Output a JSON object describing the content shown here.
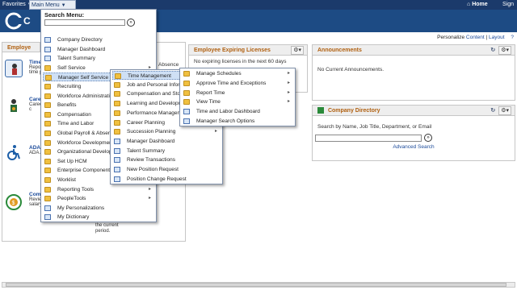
{
  "topbar": {
    "favorites": "Favorites",
    "main_menu": "Main Menu",
    "home": "Home",
    "sign_out": "Sign"
  },
  "personalize": {
    "prefix": "Personalize",
    "content": "Content",
    "sep": "|",
    "layout": "Layout",
    "help": "?"
  },
  "employee_pagelet": {
    "title": "Employe",
    "absence": "Absence",
    "current_period": "the current period.",
    "tiles": [
      {
        "title": "Time",
        "desc": "Repo and t a day time p"
      },
      {
        "title": "Care",
        "desc": "Caree jobs a your c"
      },
      {
        "title": "ADA Acco Requ",
        "desc": "ADA Acco Requ"
      },
      {
        "title": "Comp Histo",
        "desc": "Revie comp histor salary options."
      }
    ]
  },
  "licenses_pagelet": {
    "title": "Employee Expiring Licenses",
    "empty": "No expiring licenses in the next 60 days"
  },
  "announcements_pagelet": {
    "title": "Announcements",
    "empty": "No Current Announcements."
  },
  "directory_pagelet": {
    "title": "Company Directory",
    "search_label": "Search by Name, Job Title, Department, or Email",
    "advanced": "Advanced Search",
    "input_value": ""
  },
  "main_menu": {
    "search_label": "Search Menu:",
    "search_value": "",
    "items": [
      {
        "label": "Company Directory",
        "type": "page",
        "arrow": false
      },
      {
        "label": "Manager Dashboard",
        "type": "page",
        "arrow": false
      },
      {
        "label": "Talent Summary",
        "type": "page",
        "arrow": false
      },
      {
        "label": "Self Service",
        "type": "folder",
        "arrow": true
      },
      {
        "label": "Manager Self Service",
        "type": "folder",
        "arrow": true
      },
      {
        "label": "Recruiting",
        "type": "folder",
        "arrow": true
      },
      {
        "label": "Workforce Administration",
        "type": "folder",
        "arrow": true
      },
      {
        "label": "Benefits",
        "type": "folder",
        "arrow": true
      },
      {
        "label": "Compensation",
        "type": "folder",
        "arrow": true
      },
      {
        "label": "Time and Labor",
        "type": "folder",
        "arrow": true
      },
      {
        "label": "Global Payroll & Absence",
        "type": "folder",
        "arrow": true
      },
      {
        "label": "Workforce Development",
        "type": "folder",
        "arrow": true
      },
      {
        "label": "Organizational Development",
        "type": "folder",
        "arrow": true
      },
      {
        "label": "Set Up HCM",
        "type": "folder",
        "arrow": true
      },
      {
        "label": "Enterprise Components",
        "type": "folder",
        "arrow": true
      },
      {
        "label": "Worklist",
        "type": "folder",
        "arrow": true
      },
      {
        "label": "Reporting Tools",
        "type": "folder",
        "arrow": true
      },
      {
        "label": "PeopleTools",
        "type": "folder",
        "arrow": true
      },
      {
        "label": "My Personalizations",
        "type": "page",
        "arrow": false
      },
      {
        "label": "My Dictionary",
        "type": "page",
        "arrow": false
      }
    ]
  },
  "submenu_mss": {
    "items": [
      {
        "label": "Time Management",
        "type": "folder",
        "arrow": true
      },
      {
        "label": "Job and Personal Information",
        "type": "folder",
        "arrow": true
      },
      {
        "label": "Compensation and Stock",
        "type": "folder",
        "arrow": true
      },
      {
        "label": "Learning and Development",
        "type": "folder",
        "arrow": true
      },
      {
        "label": "Performance Management",
        "type": "folder",
        "arrow": true
      },
      {
        "label": "Career Planning",
        "type": "folder",
        "arrow": true
      },
      {
        "label": "Succession Planning",
        "type": "folder",
        "arrow": true
      },
      {
        "label": "Manager Dashboard",
        "type": "page",
        "arrow": false
      },
      {
        "label": "Talent Summary",
        "type": "page",
        "arrow": false
      },
      {
        "label": "Review Transactions",
        "type": "page",
        "arrow": false
      },
      {
        "label": "New Position Request",
        "type": "page",
        "arrow": false
      },
      {
        "label": "Position Change Request",
        "type": "page",
        "arrow": false
      }
    ]
  },
  "submenu_tm": {
    "items": [
      {
        "label": "Manage Schedules",
        "type": "folder",
        "arrow": true
      },
      {
        "label": "Approve Time and Exceptions",
        "type": "folder",
        "arrow": true
      },
      {
        "label": "Report Time",
        "type": "folder",
        "arrow": true
      },
      {
        "label": "View Time",
        "type": "folder",
        "arrow": true
      },
      {
        "label": "Time and Labor Dashboard",
        "type": "page",
        "arrow": false
      },
      {
        "label": "Manager Search Options",
        "type": "page",
        "arrow": false
      }
    ]
  },
  "colors": {
    "topbar": "#1b3a6b",
    "header": "#1d4b84",
    "pagelet_title": "#b06010",
    "link": "#1b4a9a"
  }
}
